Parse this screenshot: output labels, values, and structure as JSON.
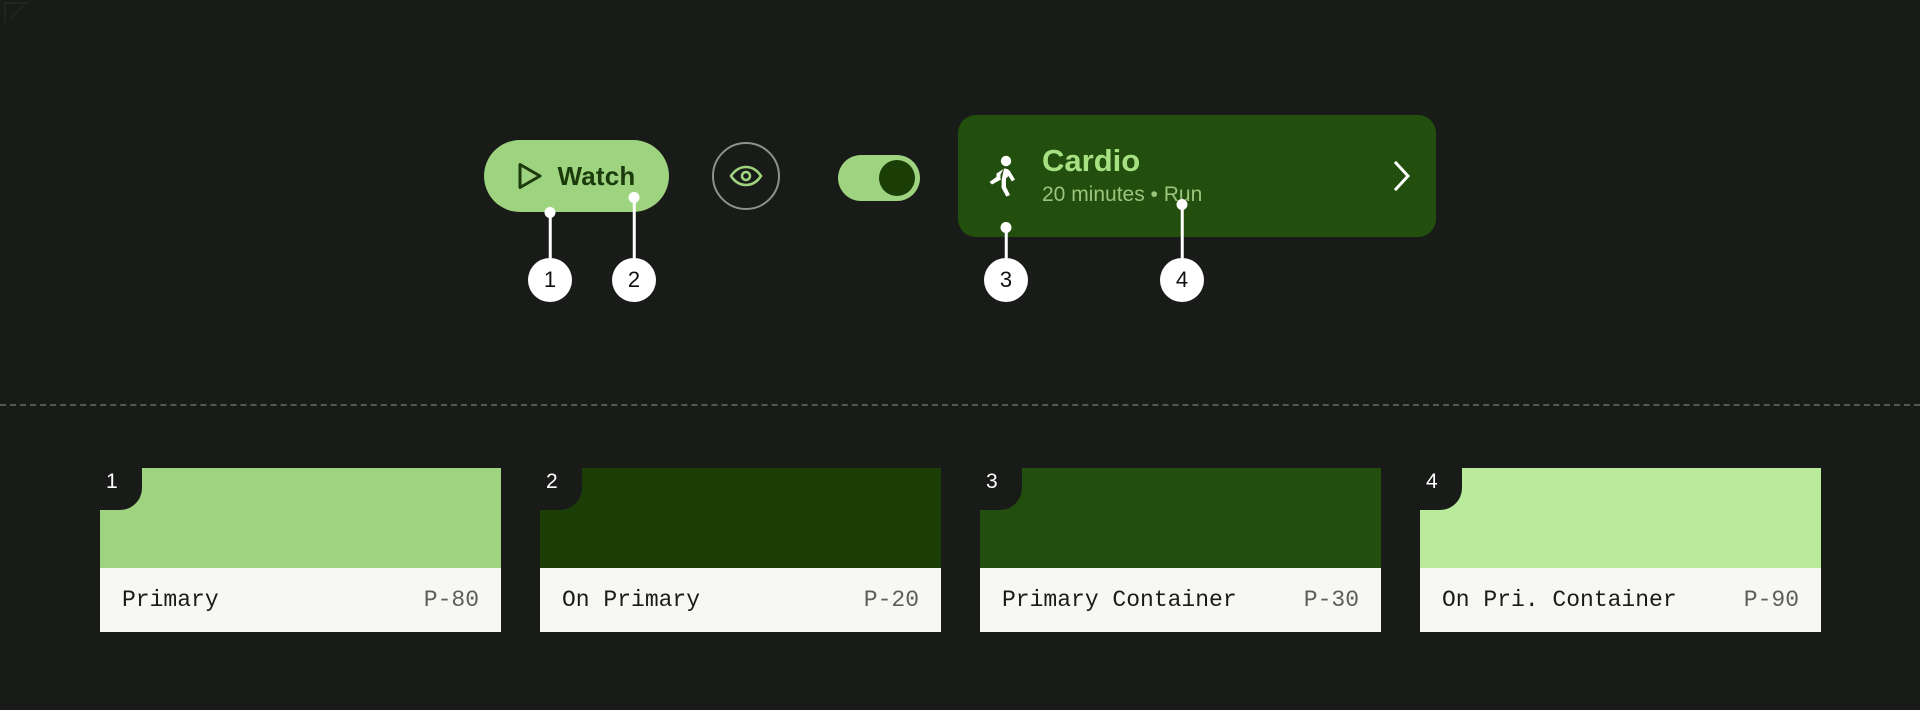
{
  "theme": {
    "background": "#191b18",
    "divider_color": "#55584f",
    "callout_color": "#ffffff"
  },
  "components": {
    "watch_button": {
      "label": "Watch",
      "icon": "play-triangle-icon",
      "background": "#9ed37f",
      "text_color": "#1c3b0c"
    },
    "eye_button": {
      "icon": "eye-icon",
      "border_color": "#8e918c",
      "icon_color": "#9ed37f"
    },
    "toggle": {
      "state": "on",
      "track_color": "#9ed37f",
      "thumb_color": "#1b3d06"
    },
    "cardio_card": {
      "icon": "running-person-icon",
      "title": "Cardio",
      "subtitle": "20 minutes • Run",
      "chevron": "chevron-right-icon",
      "background": "#224f0d",
      "title_color": "#a7e083",
      "subtitle_color": "#9bc47c"
    }
  },
  "callouts": [
    {
      "number": "1"
    },
    {
      "number": "2"
    },
    {
      "number": "3"
    },
    {
      "number": "4"
    }
  ],
  "swatches": [
    {
      "number": "1",
      "name": "Primary",
      "tone": "P-80",
      "color": "#9ed37f"
    },
    {
      "number": "2",
      "name": "On Primary",
      "tone": "P-20",
      "color": "#1b3d06"
    },
    {
      "number": "3",
      "name": "Primary Container",
      "tone": "P-30",
      "color": "#224f0d"
    },
    {
      "number": "4",
      "name": "On Pri. Container",
      "tone": "P-90",
      "color": "#b9eb9a"
    }
  ]
}
